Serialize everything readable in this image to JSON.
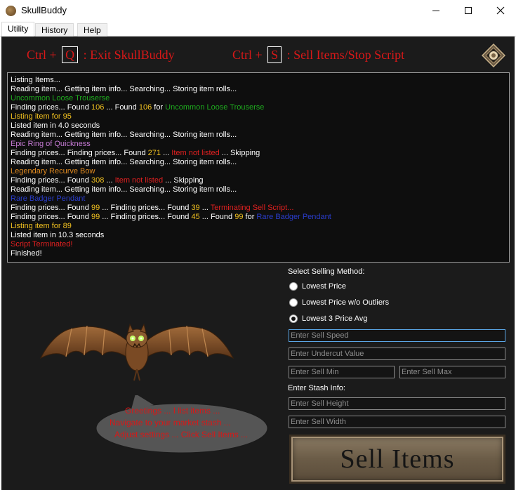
{
  "window": {
    "title": "SkullBuddy"
  },
  "tabs": [
    {
      "label": "Utility",
      "active": true
    },
    {
      "label": "History",
      "active": false
    },
    {
      "label": "Help",
      "active": false
    }
  ],
  "hotkeys": {
    "exit": {
      "prefix": "Ctrl +",
      "key": "Q",
      "action": ": Exit SkullBuddy"
    },
    "sell": {
      "prefix": "Ctrl +",
      "key": "S",
      "action": ": Sell Items/Stop Script"
    }
  },
  "log": [
    [
      {
        "t": "Listing Items...",
        "c": "white"
      }
    ],
    [
      {
        "t": "Reading item... Getting item info... Searching... Storing item rolls...",
        "c": "white"
      }
    ],
    [
      {
        "t": "Uncommon Loose Trouserse",
        "c": "green"
      }
    ],
    [
      {
        "t": "Finding prices... Found ",
        "c": "white"
      },
      {
        "t": "106",
        "c": "yellow"
      },
      {
        "t": " ... Found ",
        "c": "white"
      },
      {
        "t": "106",
        "c": "yellow"
      },
      {
        "t": " for ",
        "c": "white"
      },
      {
        "t": "Uncommon Loose Trouserse",
        "c": "green"
      }
    ],
    [
      {
        "t": "Listing item for 95",
        "c": "yellow"
      }
    ],
    [
      {
        "t": "Listed item in 4.0 seconds",
        "c": "white"
      }
    ],
    [
      {
        "t": "Reading item... Getting item info... Searching... Storing item rolls...",
        "c": "white"
      }
    ],
    [
      {
        "t": "Epic Ring of Quickness",
        "c": "purple"
      }
    ],
    [
      {
        "t": "Finding prices... Finding prices... Found ",
        "c": "white"
      },
      {
        "t": "271",
        "c": "yellow"
      },
      {
        "t": " ... ",
        "c": "white"
      },
      {
        "t": "Item not listed",
        "c": "red"
      },
      {
        "t": " ... Skipping",
        "c": "white"
      }
    ],
    [
      {
        "t": "Reading item... Getting item info... Searching... Storing item rolls...",
        "c": "white"
      }
    ],
    [
      {
        "t": "Legendary Recurve Bow",
        "c": "orange"
      }
    ],
    [
      {
        "t": "Finding prices... Found ",
        "c": "white"
      },
      {
        "t": "308",
        "c": "yellow"
      },
      {
        "t": " ... ",
        "c": "white"
      },
      {
        "t": "Item not listed",
        "c": "red"
      },
      {
        "t": " ... Skipping",
        "c": "white"
      }
    ],
    [
      {
        "t": "Reading item... Getting item info... Searching... Storing item rolls...",
        "c": "white"
      }
    ],
    [
      {
        "t": "Rare Badger Pendant",
        "c": "blue"
      }
    ],
    [
      {
        "t": "Finding prices... Found ",
        "c": "white"
      },
      {
        "t": "99",
        "c": "yellow"
      },
      {
        "t": " ... Finding prices... Found ",
        "c": "white"
      },
      {
        "t": "39",
        "c": "yellow"
      },
      {
        "t": " ... ",
        "c": "white"
      },
      {
        "t": "Terminating Sell Script...",
        "c": "red"
      }
    ],
    [
      {
        "t": "Finding prices... Found ",
        "c": "white"
      },
      {
        "t": "99",
        "c": "yellow"
      },
      {
        "t": " ... Finding prices... Found ",
        "c": "white"
      },
      {
        "t": "45",
        "c": "yellow"
      },
      {
        "t": " ... Found ",
        "c": "white"
      },
      {
        "t": "99",
        "c": "yellow"
      },
      {
        "t": " for ",
        "c": "white"
      },
      {
        "t": "Rare Badger Pendant",
        "c": "blue"
      }
    ],
    [
      {
        "t": "Listing item for 89",
        "c": "yellow"
      }
    ],
    [
      {
        "t": "Listed item in 10.3 seconds",
        "c": "white"
      }
    ],
    [
      {
        "t": "Script Terminated!",
        "c": "red"
      }
    ],
    [
      {
        "t": "Finished!",
        "c": "white"
      }
    ]
  ],
  "settings": {
    "method_label": "Select Selling Method:",
    "methods": [
      {
        "label": "Lowest Price",
        "checked": false
      },
      {
        "label": "Lowest Price w/o Outliers",
        "checked": false
      },
      {
        "label": "Lowest 3 Price Avg",
        "checked": true
      }
    ],
    "sell_speed_placeholder": "Enter Sell Speed",
    "undercut_placeholder": "Enter Undercut Value",
    "sell_min_placeholder": "Enter Sell Min",
    "sell_max_placeholder": "Enter Sell Max",
    "stash_label": "Enter Stash Info:",
    "stash_height_placeholder": "Enter Sell Height",
    "stash_width_placeholder": "Enter Sell Width"
  },
  "sell_button": {
    "label": "Sell Items"
  },
  "bubble": {
    "line1": "Greetings ... I list items ...",
    "line2": "Navigate to your market stash ...",
    "line3": "Adjust settings ... Click Sell Items ..."
  },
  "colors": {
    "white": "#ffffff",
    "green": "#1eaa1e",
    "yellow": "#f0c020",
    "purple": "#c77bd6",
    "orange": "#e08a20",
    "red": "#e02020",
    "blue": "#2a3dcc",
    "accent_red": "#d81818",
    "panel": "#1b1b1b"
  },
  "icons": {
    "app": "skull-icon",
    "settings": "gear-icon",
    "mascot": "bat-icon"
  }
}
